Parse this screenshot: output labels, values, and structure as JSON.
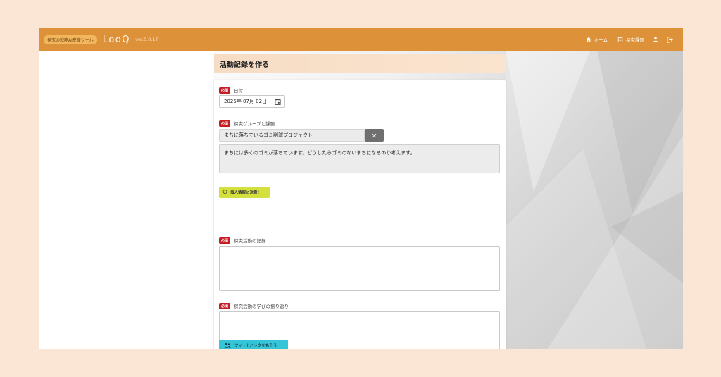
{
  "header": {
    "tagline": "探究の戦略AI支援ツール",
    "logo": "LooQ",
    "version": "ver.0.0.17",
    "nav": {
      "home_label": "ホーム",
      "projects_label": "探究課題"
    }
  },
  "page": {
    "title": "活動記録を作る"
  },
  "form": {
    "required_badge": "必須",
    "date": {
      "label": "日付",
      "value": "2025年 07月 02日"
    },
    "group": {
      "label": "探究グループと課題",
      "selected": "まちに落ちているゴミ削減プロジェクト",
      "description": "まちには多くのゴミが落ちています。どうしたらゴミのないまちになるのか考えます。"
    },
    "privacy_button": "個人情報に注意！",
    "activity_record": {
      "label": "探究活動の記録",
      "value": ""
    },
    "reflection": {
      "label": "探究活動の学びの振り返り",
      "value": ""
    },
    "feedback_button": "フィードバックをもらう"
  },
  "colors": {
    "header": "#dd923a",
    "required": "#c41d24",
    "privacy": "#d4e03d",
    "feedback": "#35c5d8",
    "frame": "#fbe6d6"
  }
}
